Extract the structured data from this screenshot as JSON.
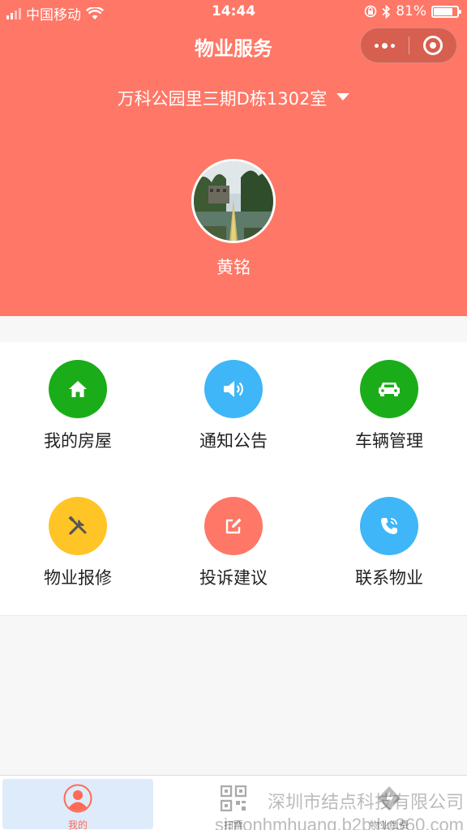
{
  "status_bar": {
    "carrier": "中国移动",
    "time": "14:44",
    "battery": "81%",
    "battery_level": 0.81
  },
  "nav": {
    "title": "物业服务"
  },
  "header": {
    "address": "万科公园里三期D栋1302室",
    "user_name": "黄铭"
  },
  "colors": {
    "header_bg": "#ff7766",
    "green": "#1aad19",
    "blue": "#3fb6f7",
    "yellow": "#ffc426",
    "coral": "#ff7766",
    "tab_active": "#ff6a55"
  },
  "services": [
    {
      "label": "我的房屋",
      "icon": "home-icon",
      "color": "#1aad19"
    },
    {
      "label": "通知公告",
      "icon": "speaker-icon",
      "color": "#3fb6f7"
    },
    {
      "label": "车辆管理",
      "icon": "car-icon",
      "color": "#1aad19"
    },
    {
      "label": "物业报修",
      "icon": "tools-icon",
      "color": "#ffc426"
    },
    {
      "label": "投诉建议",
      "icon": "edit-icon",
      "color": "#ff7766"
    },
    {
      "label": "联系物业",
      "icon": "phone-icon",
      "color": "#3fb6f7"
    }
  ],
  "tabbar": {
    "tabs": [
      {
        "label": "我的",
        "icon": "user-icon",
        "active": true
      },
      {
        "label": "扫票",
        "icon": "qrcode-icon",
        "active": false
      },
      {
        "label": "物业缴费",
        "icon": "payment-icon",
        "active": false
      }
    ]
  },
  "watermark": {
    "line1": "深圳市结点科技有限公司",
    "line2": "simonhmhuang.b2b.hc360.com"
  }
}
